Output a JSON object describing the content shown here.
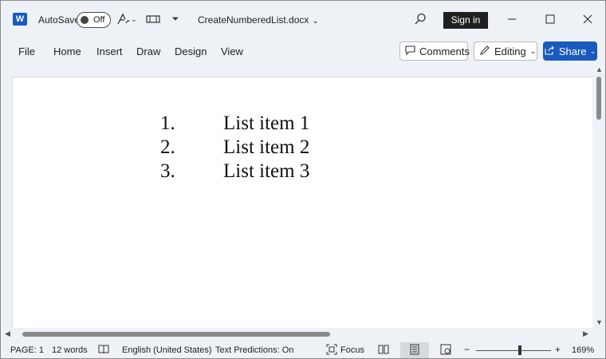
{
  "titlebar": {
    "autosave_label": "AutoSave",
    "autosave_state": "Off",
    "document_title": "CreateNumberedList.docx",
    "sign_in_label": "Sign in",
    "icons": [
      "word-logo-icon",
      "format-painter-icon",
      "chevron-down-icon",
      "layout-icon",
      "customize-toolbar-icon",
      "search-icon",
      "minimize-icon",
      "maximize-icon",
      "close-icon"
    ]
  },
  "ribbon": {
    "tabs": [
      {
        "label": "File"
      },
      {
        "label": "Home"
      },
      {
        "label": "Insert"
      },
      {
        "label": "Draw"
      },
      {
        "label": "Design"
      },
      {
        "label": "View"
      }
    ],
    "comments_label": "Comments",
    "editing_label": "Editing",
    "share_label": "Share"
  },
  "document": {
    "list": [
      {
        "number": "1.",
        "text": "List item 1"
      },
      {
        "number": "2.",
        "text": "List item 2"
      },
      {
        "number": "3.",
        "text": "List item 3"
      }
    ]
  },
  "statusbar": {
    "page": "PAGE: 1",
    "words": "12 words",
    "language": "English (United States)",
    "text_predictions": "Text Predictions: On",
    "focus_label": "Focus",
    "zoom_minus": "−",
    "zoom_plus": "+",
    "zoom_level": "169%"
  },
  "colors": {
    "accent": "#185abd",
    "chrome": "#eef1f6"
  }
}
